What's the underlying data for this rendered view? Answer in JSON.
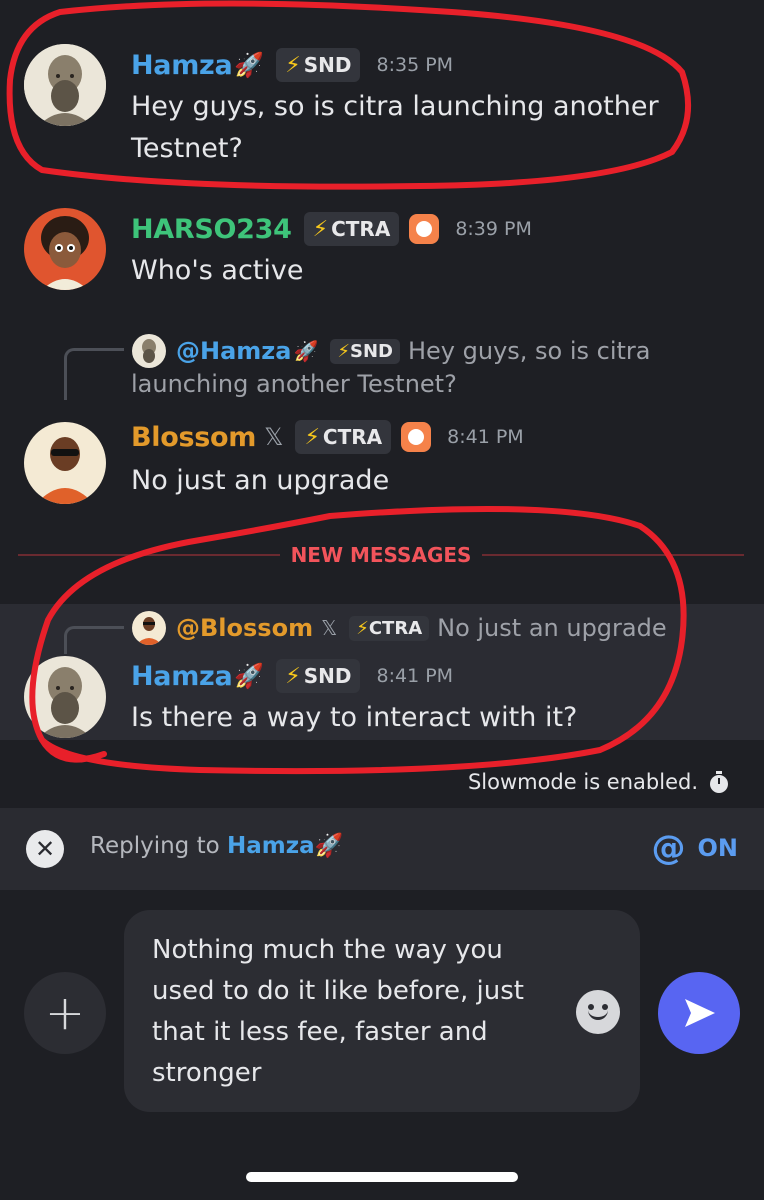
{
  "messages": [
    {
      "author": "Hamza",
      "emoji": "🚀",
      "tag": "SND",
      "time": "8:35 PM",
      "text_lines": [
        "Hey guys, so is citra launching another",
        "Testnet?"
      ]
    },
    {
      "author": "HARSO234",
      "tag": "CTRA",
      "time": "8:39 PM",
      "text_lines": [
        "Who's active"
      ]
    },
    {
      "reply": {
        "author": "@Hamza",
        "emoji": "🚀",
        "tag": "SND",
        "text_lines": [
          "Hey guys, so is citra",
          "launching another Testnet?"
        ]
      },
      "author": "Blossom",
      "xmark": "𝕏",
      "tag": "CTRA",
      "time": "8:41 PM",
      "text_lines": [
        "No just an upgrade"
      ]
    },
    {
      "reply": {
        "author": "@Blossom",
        "xmark": "𝕏",
        "tag": "CTRA",
        "text": "No just an upgrade"
      },
      "author": "Hamza",
      "emoji": "🚀",
      "tag": "SND",
      "time": "8:41 PM",
      "text_lines": [
        "Is there a way to interact with it?"
      ]
    }
  ],
  "divider_label": "NEW MESSAGES",
  "slowmode": {
    "text": "Slowmode is enabled.",
    "icon": "stopwatch-icon"
  },
  "reply_bar": {
    "prefix": "Replying to",
    "target": "Hamza",
    "emoji": "🚀",
    "mention_symbol": "@",
    "mention_state": "ON",
    "close_icon": "close-icon"
  },
  "composer": {
    "text": "Nothing much the way you used to do it like before, just that it less fee, faster and stronger",
    "text_lines": [
      "Nothing much the way you",
      "used to do it like before, just",
      "that it less fee, faster and",
      "stronger"
    ]
  },
  "icons": {
    "plus": "+",
    "bolt": "⚡"
  },
  "colors": {
    "background": "#1e1f24",
    "accent": "#5865f2",
    "new_messages": "#f2545b",
    "annotation_red": "#e8202a"
  }
}
